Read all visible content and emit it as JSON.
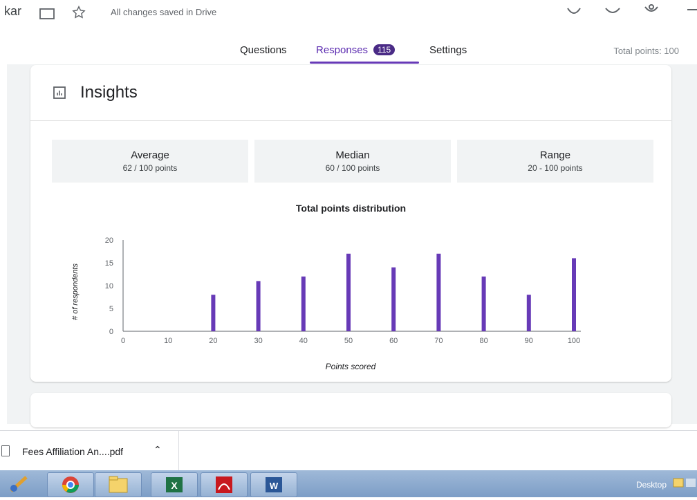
{
  "app": {
    "title_fragment": "kar",
    "saved_status": "All changes saved in Drive"
  },
  "tabs": [
    {
      "label": "Questions",
      "active": false
    },
    {
      "label": "Responses",
      "active": true,
      "badge": "115"
    },
    {
      "label": "Settings",
      "active": false
    }
  ],
  "total_points": "Total points: 100",
  "insights": {
    "title": "Insights",
    "icon": "bar-chart-icon",
    "stats": [
      {
        "label": "Average",
        "value": "62 / 100 points"
      },
      {
        "label": "Median",
        "value": "60 / 100 points"
      },
      {
        "label": "Range",
        "value": "20 - 100 points"
      }
    ]
  },
  "chart_data": {
    "type": "bar",
    "title": "Total points distribution",
    "xlabel": "Points scored",
    "ylabel": "# of respondents",
    "categories": [
      0,
      10,
      20,
      30,
      40,
      50,
      60,
      70,
      80,
      90,
      100
    ],
    "values": [
      0,
      0,
      8,
      11,
      12,
      17,
      14,
      17,
      12,
      8,
      16
    ],
    "ylim": [
      0,
      20
    ],
    "yticks": [
      0,
      5,
      10,
      15,
      20
    ],
    "grid": false,
    "color": "#673ab7"
  },
  "download": {
    "filename": "Fees Affiliation An....pdf"
  },
  "taskbar": {
    "desktop_label": "Desktop",
    "apps": [
      "paint-icon",
      "chrome-icon",
      "file-explorer-icon",
      "excel-icon",
      "acrobat-icon",
      "word-icon"
    ]
  },
  "colors": {
    "accent": "#673ab7",
    "badge": "#4a2b86"
  }
}
